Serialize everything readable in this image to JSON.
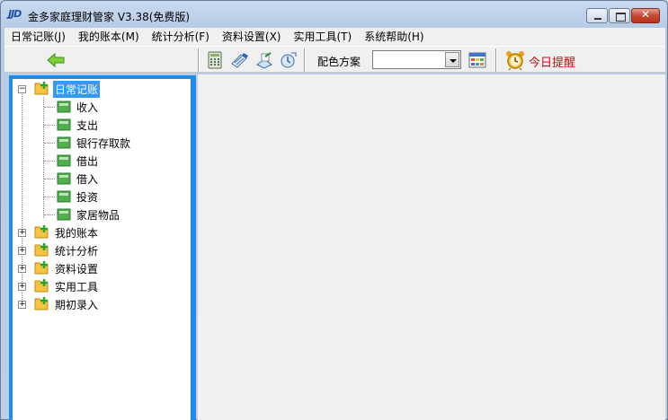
{
  "window": {
    "logo_text": "JJD",
    "title": "金多家庭理财管家 V3.38(免费版)"
  },
  "menubar": {
    "items": [
      {
        "label": "日常记账(J)"
      },
      {
        "label": "我的账本(M)"
      },
      {
        "label": "统计分析(F)"
      },
      {
        "label": "资料设置(X)"
      },
      {
        "label": "实用工具(T)"
      },
      {
        "label": "系统帮助(H)"
      }
    ]
  },
  "toolbar": {
    "palette_label": "配色方案",
    "palette_value": "",
    "reminder_label": "今日提醒"
  },
  "tree": {
    "root_expanded": {
      "label": "日常记账",
      "expander": "−",
      "children": [
        "收入",
        "支出",
        "银行存取款",
        "借出",
        "借入",
        "投资",
        "家居物品"
      ]
    },
    "collapsed": [
      {
        "label": "我的账本",
        "expander": "+"
      },
      {
        "label": "统计分析",
        "expander": "+"
      },
      {
        "label": "资料设置",
        "expander": "+"
      },
      {
        "label": "实用工具",
        "expander": "+"
      },
      {
        "label": "期初录入",
        "expander": "+"
      }
    ]
  },
  "colors": {
    "selection": "#3399ff",
    "panel_border": "#1e8de8",
    "reminder_text": "#c0140c"
  }
}
